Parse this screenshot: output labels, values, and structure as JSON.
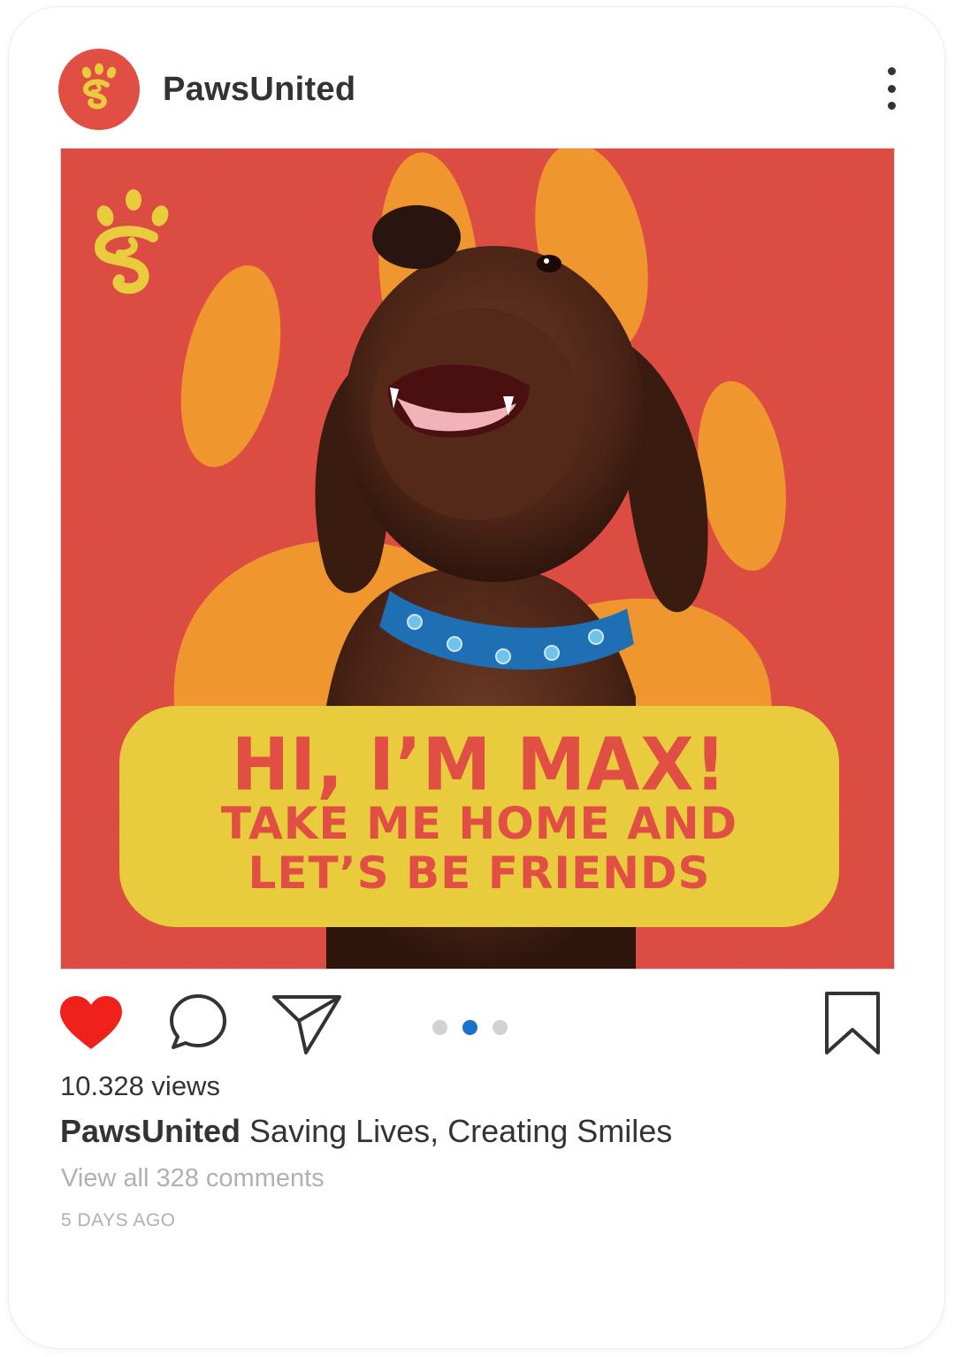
{
  "header": {
    "username": "PawsUnited",
    "avatar_icon": "paw-logo-icon",
    "more_icon": "more-vertical-icon"
  },
  "post": {
    "image_alt": "dog-photo",
    "headline": "HI, I’M MAX!",
    "subline1": "TAKE ME HOME AND",
    "subline2": "LET’S BE FRIENDS"
  },
  "actions": {
    "like_icon": "heart-icon",
    "comment_icon": "comment-icon",
    "share_icon": "send-icon",
    "save_icon": "bookmark-icon",
    "carousel_count": 3,
    "carousel_active_index": 1
  },
  "meta": {
    "views": "10.328 views",
    "caption_user": "PawsUnited",
    "caption_text": " Saving Lives, Creating Smiles",
    "comments_link": "View all 328 comments",
    "timestamp": "5 DAYS AGO"
  },
  "colors": {
    "brand_red": "#e04e44",
    "brand_yellow": "#e9cc3e",
    "paw_orange": "#f0962e",
    "like_red": "#f0201a",
    "carousel_active": "#1a73c8"
  }
}
